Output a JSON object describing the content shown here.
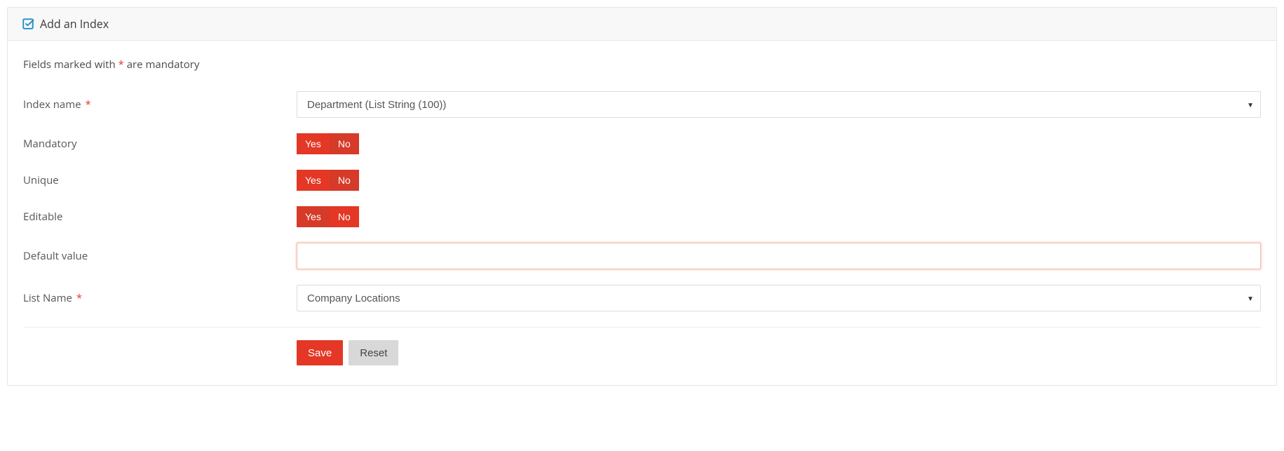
{
  "header": {
    "title": "Add an Index",
    "icon": "check-square-icon",
    "icon_color": "#1f8ec7"
  },
  "note": {
    "prefix": "Fields marked with ",
    "asterisk": "*",
    "suffix": " are mandatory"
  },
  "fields": {
    "index_name": {
      "label": "Index name",
      "required": true,
      "value": "Department (List String (100))"
    },
    "mandatory": {
      "label": "Mandatory",
      "yes": "Yes",
      "no": "No",
      "selected": "yes"
    },
    "unique": {
      "label": "Unique",
      "yes": "Yes",
      "no": "No",
      "selected": "yes"
    },
    "editable": {
      "label": "Editable",
      "yes": "Yes",
      "no": "No",
      "selected": "no"
    },
    "default_value": {
      "label": "Default value",
      "value": ""
    },
    "list_name": {
      "label": "List Name",
      "required": true,
      "value": "Company Locations"
    }
  },
  "buttons": {
    "save": "Save",
    "reset": "Reset"
  }
}
